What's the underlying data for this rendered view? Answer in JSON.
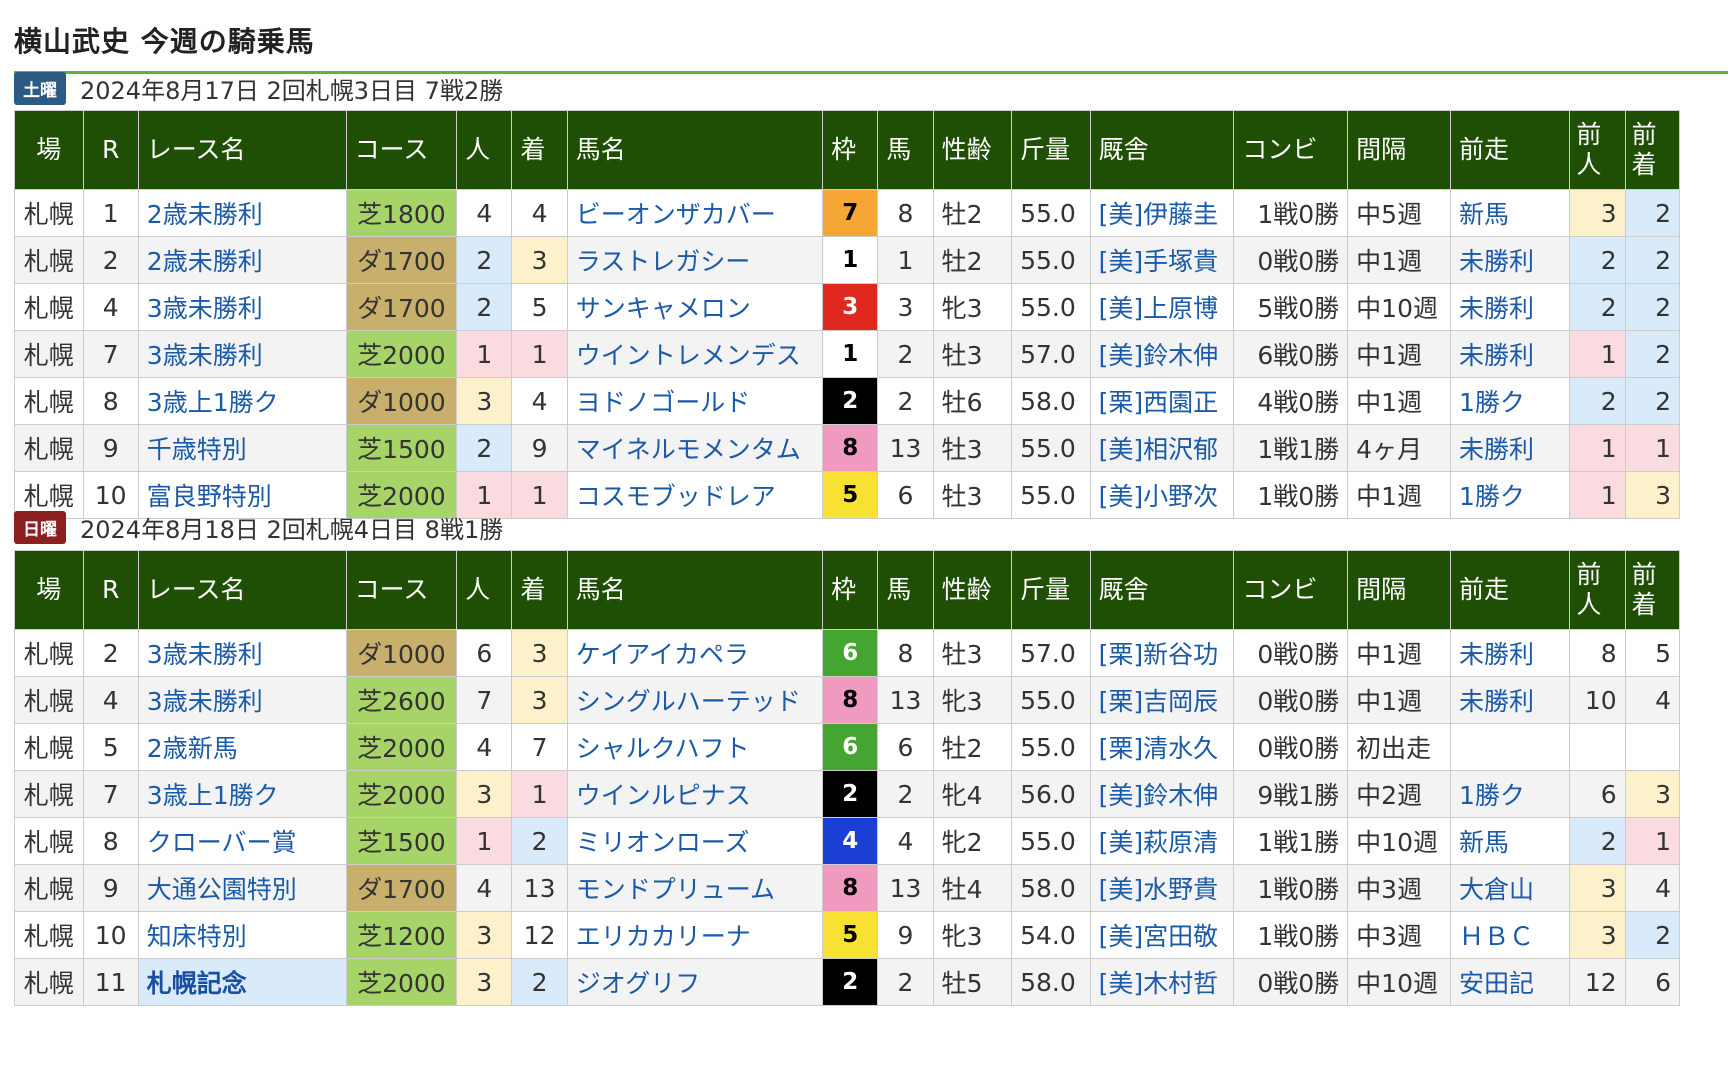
{
  "page_title": "横山武史 今週の騎乗馬",
  "headers": [
    "場",
    "R",
    "レース名",
    "コース",
    "人",
    "着",
    "馬名",
    "枠",
    "馬",
    "性齢",
    "斤量",
    "厩舎",
    "コンビ",
    "間隔",
    "前走",
    "前人",
    "前着"
  ],
  "days": [
    {
      "badge": "土曜",
      "info": "2024年8月17日 2回札幌3日目 7戦2勝",
      "rows": [
        {
          "venue": "札幌",
          "r": "1",
          "race": "2歳未勝利",
          "course": "芝1800",
          "pop": "4",
          "finish": "4",
          "horse": "ビーオンザカバー",
          "waku": "7",
          "num": "8",
          "sex": "牡2",
          "weight": "55.0",
          "stable": "[美]伊藤圭",
          "combo": "1戦0勝",
          "interval": "中5週",
          "prev": "新馬",
          "prev_pop": "3",
          "prev_fin": "2"
        },
        {
          "venue": "札幌",
          "r": "2",
          "race": "2歳未勝利",
          "course": "ダ1700",
          "pop": "2",
          "finish": "3",
          "horse": "ラストレガシー",
          "waku": "1",
          "num": "1",
          "sex": "牡2",
          "weight": "55.0",
          "stable": "[美]手塚貴",
          "combo": "0戦0勝",
          "interval": "中1週",
          "prev": "未勝利",
          "prev_pop": "2",
          "prev_fin": "2"
        },
        {
          "venue": "札幌",
          "r": "4",
          "race": "3歳未勝利",
          "course": "ダ1700",
          "pop": "2",
          "finish": "5",
          "horse": "サンキャメロン",
          "waku": "3",
          "num": "3",
          "sex": "牝3",
          "weight": "55.0",
          "stable": "[美]上原博",
          "combo": "5戦0勝",
          "interval": "中10週",
          "prev": "未勝利",
          "prev_pop": "2",
          "prev_fin": "2"
        },
        {
          "venue": "札幌",
          "r": "7",
          "race": "3歳未勝利",
          "course": "芝2000",
          "pop": "1",
          "finish": "1",
          "horse": "ウイントレメンデス",
          "waku": "1",
          "num": "2",
          "sex": "牡3",
          "weight": "57.0",
          "stable": "[美]鈴木伸",
          "combo": "6戦0勝",
          "interval": "中1週",
          "prev": "未勝利",
          "prev_pop": "1",
          "prev_fin": "2"
        },
        {
          "venue": "札幌",
          "r": "8",
          "race": "3歳上1勝ク",
          "course": "ダ1000",
          "pop": "3",
          "finish": "4",
          "horse": "ヨドノゴールド",
          "waku": "2",
          "num": "2",
          "sex": "牡6",
          "weight": "58.0",
          "stable": "[栗]西園正",
          "combo": "4戦0勝",
          "interval": "中1週",
          "prev": "1勝ク",
          "prev_pop": "2",
          "prev_fin": "2"
        },
        {
          "venue": "札幌",
          "r": "9",
          "race": "千歳特別",
          "course": "芝1500",
          "pop": "2",
          "finish": "9",
          "horse": "マイネルモメンタム",
          "waku": "8",
          "num": "13",
          "sex": "牡3",
          "weight": "55.0",
          "stable": "[美]相沢郁",
          "combo": "1戦1勝",
          "interval": "4ヶ月",
          "prev": "未勝利",
          "prev_pop": "1",
          "prev_fin": "1"
        },
        {
          "venue": "札幌",
          "r": "10",
          "race": "富良野特別",
          "course": "芝2000",
          "pop": "1",
          "finish": "1",
          "horse": "コスモブッドレア",
          "waku": "5",
          "num": "6",
          "sex": "牡3",
          "weight": "55.0",
          "stable": "[美]小野次",
          "combo": "1戦0勝",
          "interval": "中1週",
          "prev": "1勝ク",
          "prev_pop": "1",
          "prev_fin": "3"
        }
      ]
    },
    {
      "badge": "日曜",
      "info": "2024年8月18日 2回札幌4日目 8戦1勝",
      "rows": [
        {
          "venue": "札幌",
          "r": "2",
          "race": "3歳未勝利",
          "course": "ダ1000",
          "pop": "6",
          "finish": "3",
          "horse": "ケイアイカペラ",
          "waku": "6",
          "num": "8",
          "sex": "牡3",
          "weight": "57.0",
          "stable": "[栗]新谷功",
          "combo": "0戦0勝",
          "interval": "中1週",
          "prev": "未勝利",
          "prev_pop": "8",
          "prev_fin": "5"
        },
        {
          "venue": "札幌",
          "r": "4",
          "race": "3歳未勝利",
          "course": "芝2600",
          "pop": "7",
          "finish": "3",
          "horse": "シングルハーテッド",
          "waku": "8",
          "num": "13",
          "sex": "牝3",
          "weight": "55.0",
          "stable": "[栗]吉岡辰",
          "combo": "0戦0勝",
          "interval": "中1週",
          "prev": "未勝利",
          "prev_pop": "10",
          "prev_fin": "4"
        },
        {
          "venue": "札幌",
          "r": "5",
          "race": "2歳新馬",
          "course": "芝2000",
          "pop": "4",
          "finish": "7",
          "horse": "シャルクハフト",
          "waku": "6",
          "num": "6",
          "sex": "牡2",
          "weight": "55.0",
          "stable": "[栗]清水久",
          "combo": "0戦0勝",
          "interval": "初出走",
          "prev": "",
          "prev_pop": "",
          "prev_fin": ""
        },
        {
          "venue": "札幌",
          "r": "7",
          "race": "3歳上1勝ク",
          "course": "芝2000",
          "pop": "3",
          "finish": "1",
          "horse": "ウインルピナス",
          "waku": "2",
          "num": "2",
          "sex": "牝4",
          "weight": "56.0",
          "stable": "[美]鈴木伸",
          "combo": "9戦1勝",
          "interval": "中2週",
          "prev": "1勝ク",
          "prev_pop": "6",
          "prev_fin": "3"
        },
        {
          "venue": "札幌",
          "r": "8",
          "race": "クローバー賞",
          "course": "芝1500",
          "pop": "1",
          "finish": "2",
          "horse": "ミリオンローズ",
          "waku": "4",
          "num": "4",
          "sex": "牝2",
          "weight": "55.0",
          "stable": "[美]萩原清",
          "combo": "1戦1勝",
          "interval": "中10週",
          "prev": "新馬",
          "prev_pop": "2",
          "prev_fin": "1"
        },
        {
          "venue": "札幌",
          "r": "9",
          "race": "大通公園特別",
          "course": "ダ1700",
          "pop": "4",
          "finish": "13",
          "horse": "モンドプリューム",
          "waku": "8",
          "num": "13",
          "sex": "牡4",
          "weight": "58.0",
          "stable": "[美]水野貴",
          "combo": "1戦0勝",
          "interval": "中3週",
          "prev": "大倉山",
          "prev_pop": "3",
          "prev_fin": "4"
        },
        {
          "venue": "札幌",
          "r": "10",
          "race": "知床特別",
          "course": "芝1200",
          "pop": "3",
          "finish": "12",
          "horse": "エリカカリーナ",
          "waku": "5",
          "num": "9",
          "sex": "牝3",
          "weight": "54.0",
          "stable": "[美]宮田敬",
          "combo": "1戦0勝",
          "interval": "中3週",
          "prev": "ＨＢＣ",
          "prev_pop": "3",
          "prev_fin": "2"
        },
        {
          "venue": "札幌",
          "r": "11",
          "race": "札幌記念",
          "course": "芝2000",
          "pop": "3",
          "finish": "2",
          "horse": "ジオグリフ",
          "waku": "2",
          "num": "2",
          "sex": "牡5",
          "weight": "58.0",
          "stable": "[美]木村哲",
          "combo": "0戦0勝",
          "interval": "中10週",
          "prev": "安田記",
          "prev_pop": "12",
          "prev_fin": "6",
          "featured": true
        }
      ]
    }
  ]
}
